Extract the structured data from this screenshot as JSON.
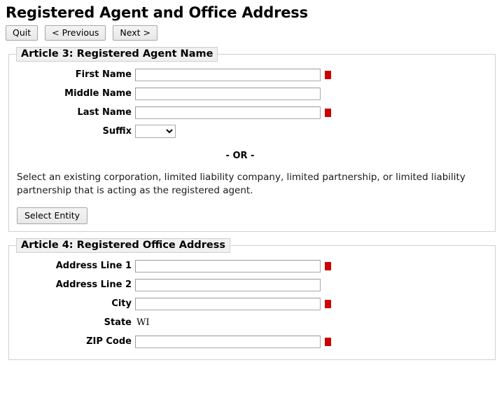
{
  "page": {
    "title": "Registered Agent and Office Address"
  },
  "toolbar": {
    "quit_label": "Quit",
    "previous_label": "< Previous",
    "next_label": "Next >"
  },
  "colors": {
    "required_marker": "#cc0000",
    "legend_background": "#f0f0f0",
    "fieldset_border": "#d0d0d0"
  },
  "article3": {
    "legend": "Article 3: Registered Agent Name",
    "fields": [
      {
        "label": "First Name",
        "value": "",
        "placeholder": "",
        "required": true,
        "type": "text"
      },
      {
        "label": "Middle Name",
        "value": "",
        "placeholder": "",
        "required": false,
        "type": "text"
      },
      {
        "label": "Last Name",
        "value": "",
        "placeholder": "",
        "required": true,
        "type": "text"
      },
      {
        "label": "Suffix",
        "value": "",
        "placeholder": "",
        "required": false,
        "type": "select",
        "selected_option": "",
        "options": [
          ""
        ]
      }
    ],
    "or_separator": "- OR -",
    "description": "Select an existing corporation, limited liability company, limited partnership, or limited liability partnership that is acting as the registered agent.",
    "select_entity_label": "Select Entity"
  },
  "article4": {
    "legend": "Article 4: Registered Office Address",
    "fields": [
      {
        "label": "Address Line 1",
        "value": "",
        "placeholder": "",
        "required": true,
        "type": "text"
      },
      {
        "label": "Address Line 2",
        "value": "",
        "placeholder": "",
        "required": false,
        "type": "text"
      },
      {
        "label": "City",
        "value": "",
        "placeholder": "",
        "required": true,
        "type": "text"
      },
      {
        "label": "State",
        "value": "WI",
        "required": false,
        "type": "static"
      },
      {
        "label": "ZIP Code",
        "value": "",
        "placeholder": "",
        "required": true,
        "type": "text"
      }
    ]
  }
}
